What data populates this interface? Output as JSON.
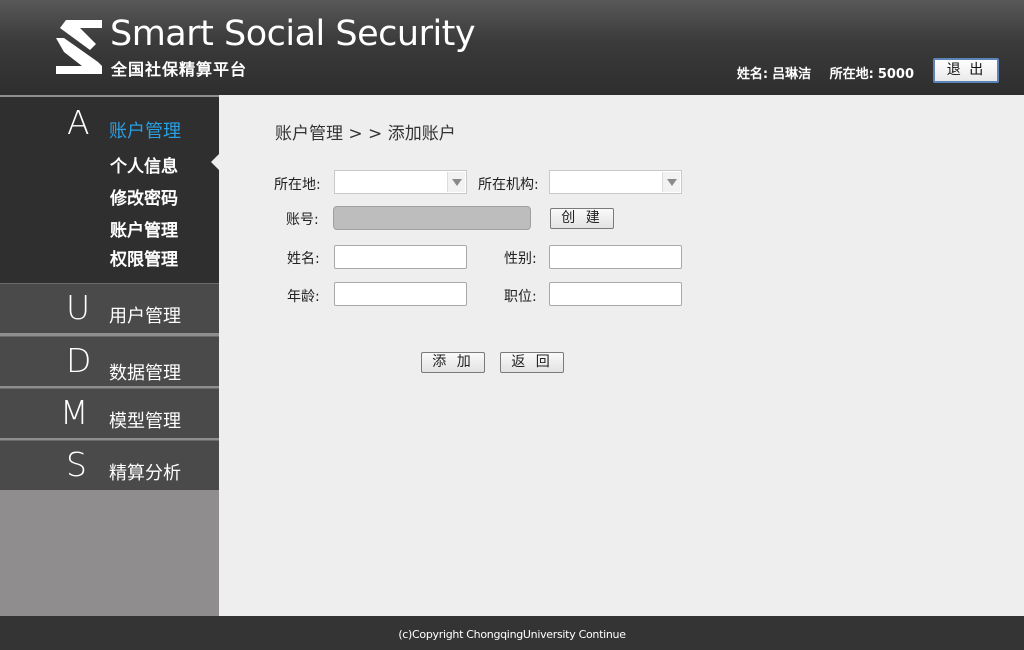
{
  "header": {
    "title": "Smart Social Security",
    "subtitle": "全国社保精算平台",
    "user_label": "姓名:",
    "user_name": "吕琳洁",
    "location_label": "所在地:",
    "location_value": "5000",
    "logout_label": "退 出",
    "logo_icon": "ss-logo-icon"
  },
  "sidebar": {
    "open_section": {
      "letter": "A",
      "label": "账户管理",
      "items": [
        {
          "label": "个人信息"
        },
        {
          "label": "修改密码"
        },
        {
          "label": "账户管理"
        },
        {
          "label": "权限管理"
        }
      ]
    },
    "sections": [
      {
        "letter": "U",
        "label": "用户管理"
      },
      {
        "letter": "D",
        "label": "数据管理"
      },
      {
        "letter": "M",
        "label": "模型管理"
      },
      {
        "letter": "S",
        "label": "精算分析"
      }
    ]
  },
  "main": {
    "breadcrumb": "账户管理 > > 添加账户",
    "form": {
      "location_label": "所在地:",
      "location_value": "",
      "org_label": "所在机构:",
      "org_value": "",
      "account_label": "账号:",
      "account_value": "",
      "create_label": "创 建",
      "name_label": "姓名:",
      "name_value": "",
      "gender_label": "性别:",
      "gender_value": "",
      "age_label": "年龄:",
      "age_value": "",
      "position_label": "职位:",
      "position_value": "",
      "add_label": "添 加",
      "back_label": "返 回"
    }
  },
  "footer": {
    "copyright": "(c)Copyright ChongqingUniversity Continue"
  },
  "colors": {
    "accent": "#27a0e6",
    "header_bg": "#3a3a3a",
    "sidebar_bg": "#4a4a4a"
  }
}
